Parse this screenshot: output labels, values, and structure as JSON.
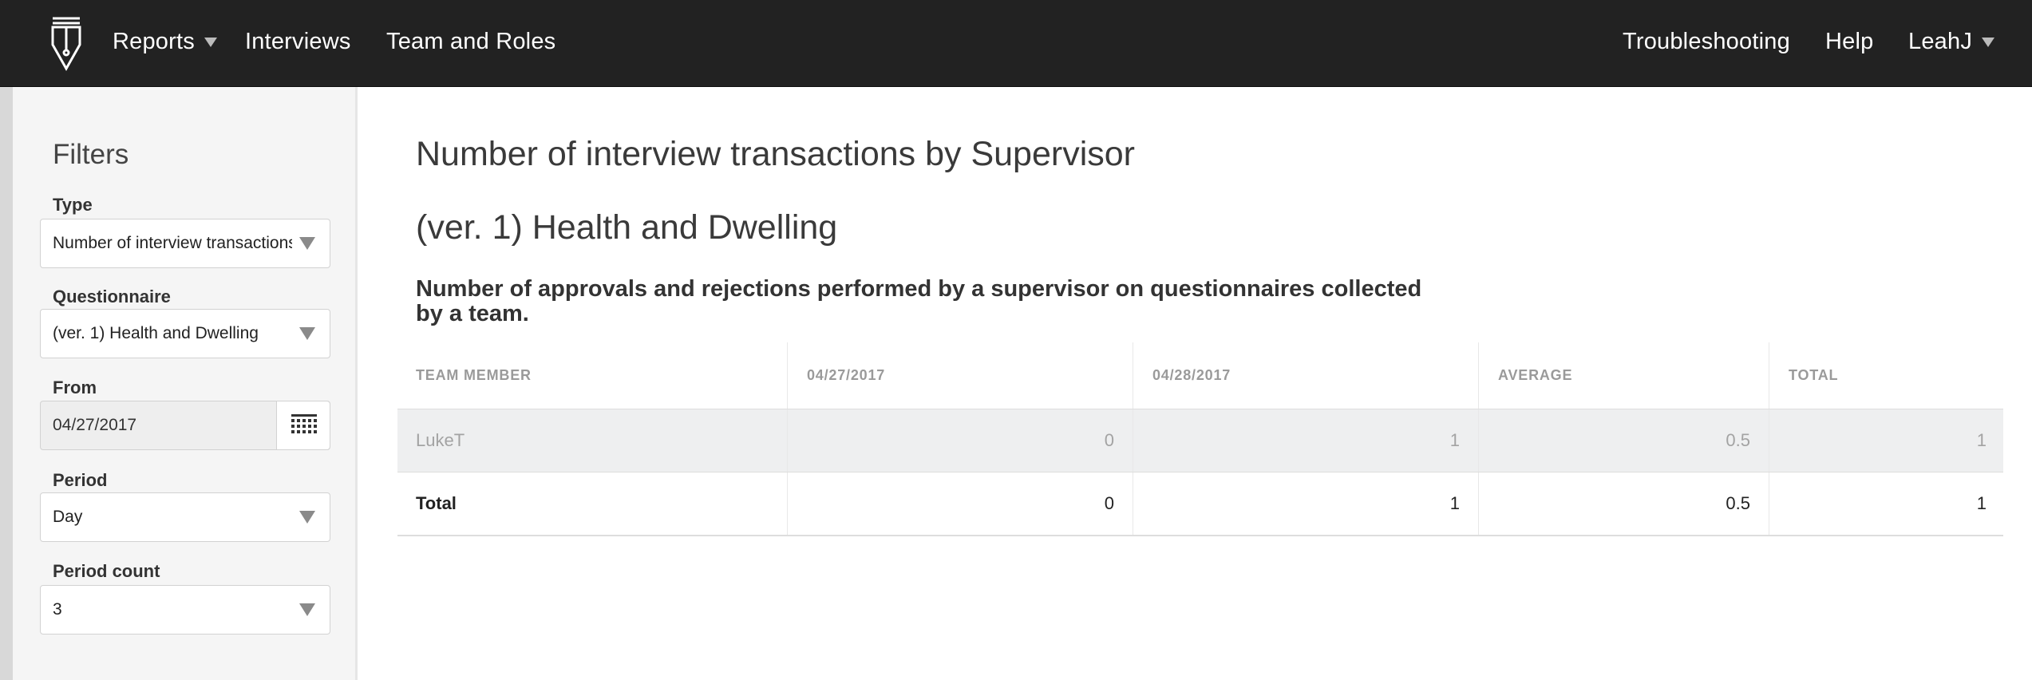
{
  "app": {
    "logo_icon": "pen-nib-logo-icon"
  },
  "nav": {
    "reports": "Reports",
    "interviews": "Interviews",
    "team_and_roles": "Team and Roles",
    "troubleshooting": "Troubleshooting",
    "help": "Help",
    "user": "LeahJ"
  },
  "filters": {
    "title": "Filters",
    "type": {
      "label": "Type",
      "value": "Number of interview transactions by Supervisor"
    },
    "questionnaire": {
      "label": "Questionnaire",
      "value": "(ver. 1) Health and Dwelling"
    },
    "from": {
      "label": "From",
      "value": "04/27/2017",
      "icon": "calendar-icon"
    },
    "period": {
      "label": "Period",
      "value": "Day"
    },
    "period_count": {
      "label": "Period count",
      "value": "3"
    }
  },
  "report": {
    "title": "Number of interview transactions by Supervisor",
    "subtitle": "(ver. 1) Health and Dwelling",
    "description": "Number of approvals and rejections performed by a supervisor on questionnaires collected by a team.",
    "table": {
      "headers": [
        "TEAM MEMBER",
        "04/27/2017",
        "04/28/2017",
        "AVERAGE",
        "TOTAL"
      ],
      "rows": [
        [
          "LukeT",
          "0",
          "1",
          "0.5",
          "1"
        ]
      ],
      "total": [
        "Total",
        "0",
        "1",
        "0.5",
        "1"
      ]
    }
  },
  "colors": {
    "navbar_bg": "#222222",
    "sidebar_bg": "#f5f5f5",
    "row_highlight": "#eeeff0"
  }
}
